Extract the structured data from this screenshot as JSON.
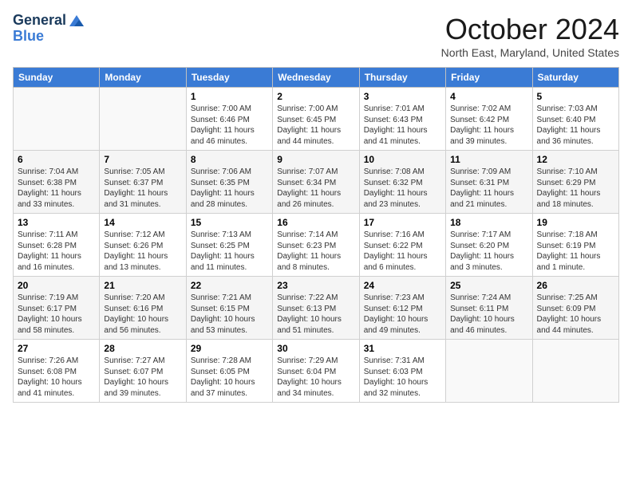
{
  "header": {
    "logo_line1": "General",
    "logo_line2": "Blue",
    "month_title": "October 2024",
    "location": "North East, Maryland, United States"
  },
  "weekdays": [
    "Sunday",
    "Monday",
    "Tuesday",
    "Wednesday",
    "Thursday",
    "Friday",
    "Saturday"
  ],
  "weeks": [
    [
      {
        "day": "",
        "info": ""
      },
      {
        "day": "",
        "info": ""
      },
      {
        "day": "1",
        "info": "Sunrise: 7:00 AM\nSunset: 6:46 PM\nDaylight: 11 hours and 46 minutes."
      },
      {
        "day": "2",
        "info": "Sunrise: 7:00 AM\nSunset: 6:45 PM\nDaylight: 11 hours and 44 minutes."
      },
      {
        "day": "3",
        "info": "Sunrise: 7:01 AM\nSunset: 6:43 PM\nDaylight: 11 hours and 41 minutes."
      },
      {
        "day": "4",
        "info": "Sunrise: 7:02 AM\nSunset: 6:42 PM\nDaylight: 11 hours and 39 minutes."
      },
      {
        "day": "5",
        "info": "Sunrise: 7:03 AM\nSunset: 6:40 PM\nDaylight: 11 hours and 36 minutes."
      }
    ],
    [
      {
        "day": "6",
        "info": "Sunrise: 7:04 AM\nSunset: 6:38 PM\nDaylight: 11 hours and 33 minutes."
      },
      {
        "day": "7",
        "info": "Sunrise: 7:05 AM\nSunset: 6:37 PM\nDaylight: 11 hours and 31 minutes."
      },
      {
        "day": "8",
        "info": "Sunrise: 7:06 AM\nSunset: 6:35 PM\nDaylight: 11 hours and 28 minutes."
      },
      {
        "day": "9",
        "info": "Sunrise: 7:07 AM\nSunset: 6:34 PM\nDaylight: 11 hours and 26 minutes."
      },
      {
        "day": "10",
        "info": "Sunrise: 7:08 AM\nSunset: 6:32 PM\nDaylight: 11 hours and 23 minutes."
      },
      {
        "day": "11",
        "info": "Sunrise: 7:09 AM\nSunset: 6:31 PM\nDaylight: 11 hours and 21 minutes."
      },
      {
        "day": "12",
        "info": "Sunrise: 7:10 AM\nSunset: 6:29 PM\nDaylight: 11 hours and 18 minutes."
      }
    ],
    [
      {
        "day": "13",
        "info": "Sunrise: 7:11 AM\nSunset: 6:28 PM\nDaylight: 11 hours and 16 minutes."
      },
      {
        "day": "14",
        "info": "Sunrise: 7:12 AM\nSunset: 6:26 PM\nDaylight: 11 hours and 13 minutes."
      },
      {
        "day": "15",
        "info": "Sunrise: 7:13 AM\nSunset: 6:25 PM\nDaylight: 11 hours and 11 minutes."
      },
      {
        "day": "16",
        "info": "Sunrise: 7:14 AM\nSunset: 6:23 PM\nDaylight: 11 hours and 8 minutes."
      },
      {
        "day": "17",
        "info": "Sunrise: 7:16 AM\nSunset: 6:22 PM\nDaylight: 11 hours and 6 minutes."
      },
      {
        "day": "18",
        "info": "Sunrise: 7:17 AM\nSunset: 6:20 PM\nDaylight: 11 hours and 3 minutes."
      },
      {
        "day": "19",
        "info": "Sunrise: 7:18 AM\nSunset: 6:19 PM\nDaylight: 11 hours and 1 minute."
      }
    ],
    [
      {
        "day": "20",
        "info": "Sunrise: 7:19 AM\nSunset: 6:17 PM\nDaylight: 10 hours and 58 minutes."
      },
      {
        "day": "21",
        "info": "Sunrise: 7:20 AM\nSunset: 6:16 PM\nDaylight: 10 hours and 56 minutes."
      },
      {
        "day": "22",
        "info": "Sunrise: 7:21 AM\nSunset: 6:15 PM\nDaylight: 10 hours and 53 minutes."
      },
      {
        "day": "23",
        "info": "Sunrise: 7:22 AM\nSunset: 6:13 PM\nDaylight: 10 hours and 51 minutes."
      },
      {
        "day": "24",
        "info": "Sunrise: 7:23 AM\nSunset: 6:12 PM\nDaylight: 10 hours and 49 minutes."
      },
      {
        "day": "25",
        "info": "Sunrise: 7:24 AM\nSunset: 6:11 PM\nDaylight: 10 hours and 46 minutes."
      },
      {
        "day": "26",
        "info": "Sunrise: 7:25 AM\nSunset: 6:09 PM\nDaylight: 10 hours and 44 minutes."
      }
    ],
    [
      {
        "day": "27",
        "info": "Sunrise: 7:26 AM\nSunset: 6:08 PM\nDaylight: 10 hours and 41 minutes."
      },
      {
        "day": "28",
        "info": "Sunrise: 7:27 AM\nSunset: 6:07 PM\nDaylight: 10 hours and 39 minutes."
      },
      {
        "day": "29",
        "info": "Sunrise: 7:28 AM\nSunset: 6:05 PM\nDaylight: 10 hours and 37 minutes."
      },
      {
        "day": "30",
        "info": "Sunrise: 7:29 AM\nSunset: 6:04 PM\nDaylight: 10 hours and 34 minutes."
      },
      {
        "day": "31",
        "info": "Sunrise: 7:31 AM\nSunset: 6:03 PM\nDaylight: 10 hours and 32 minutes."
      },
      {
        "day": "",
        "info": ""
      },
      {
        "day": "",
        "info": ""
      }
    ]
  ]
}
